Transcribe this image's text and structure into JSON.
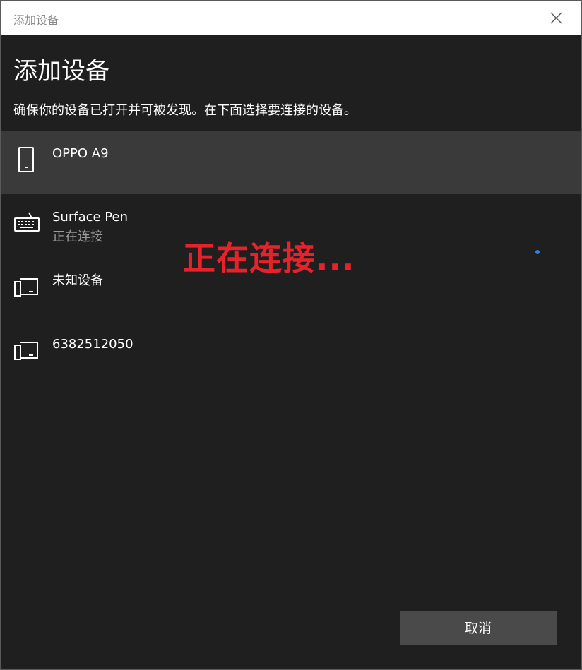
{
  "window": {
    "title": "添加设备"
  },
  "header": {
    "heading": "添加设备",
    "subtitle": "确保你的设备已打开并可被发现。在下面选择要连接的设备。"
  },
  "devices": [
    {
      "name": "OPPO A9",
      "status": "",
      "icon": "phone-icon",
      "selected": true
    },
    {
      "name": "Surface Pen",
      "status": "正在连接",
      "icon": "keyboard-icon",
      "selected": false
    },
    {
      "name": "未知设备",
      "status": "",
      "icon": "devices-icon",
      "selected": false
    },
    {
      "name": "6382512050",
      "status": "",
      "icon": "devices-icon",
      "selected": false
    }
  ],
  "overlay": {
    "text": "正在连接..."
  },
  "footer": {
    "cancel_label": "取消"
  },
  "colors": {
    "background": "#1f1f1f",
    "selected_row": "#3a3a3a",
    "overlay_text": "#e8222a",
    "accent": "#1e88e5",
    "button": "#4a4a4a"
  }
}
